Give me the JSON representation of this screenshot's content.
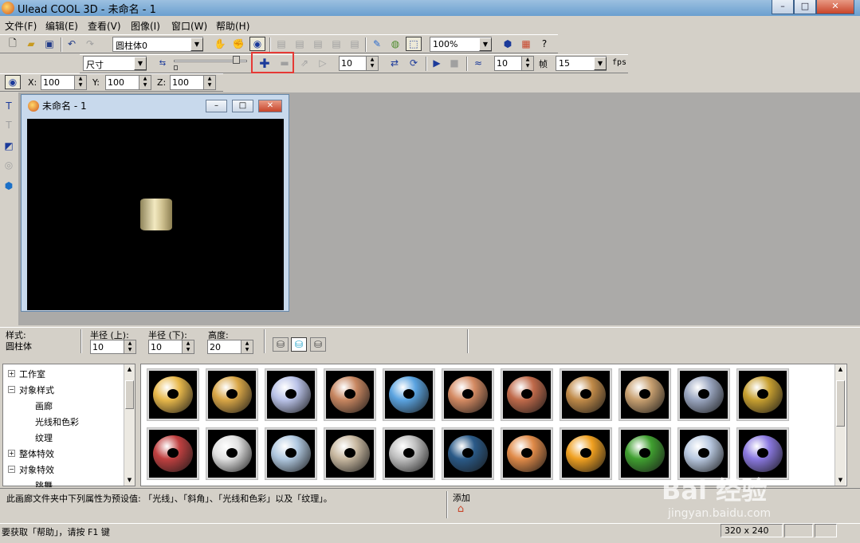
{
  "window": {
    "title": "Ulead COOL 3D - 未命名 - 1",
    "min": "–",
    "max": "□",
    "close": "✕"
  },
  "menu": [
    "文件(F)",
    "编辑(E)",
    "查看(V)",
    "图像(I)",
    "窗口(W)",
    "帮助(H)"
  ],
  "toolbar1": {
    "object_combo": "圆柱体0",
    "zoom_combo": "100%"
  },
  "toolbar2": {
    "size_combo": "尺寸",
    "frame_value": "10",
    "speed_value": "10",
    "frame_label": "帧",
    "fps_value": "15",
    "fps_label": "fps"
  },
  "toolbar3": {
    "x_label": "X:",
    "x_value": "100",
    "y_label": "Y:",
    "y_value": "100",
    "z_label": "Z:",
    "z_value": "100"
  },
  "child_window": {
    "title": "未命名 - 1"
  },
  "style_bar": {
    "style_label": "样式:",
    "style_value": "圆柱体",
    "radius_top_label": "半径 (上):",
    "radius_top_value": "10",
    "radius_bottom_label": "半径 (下):",
    "radius_bottom_value": "10",
    "height_label": "高度:",
    "height_value": "20"
  },
  "tree": [
    {
      "label": "工作室",
      "sign": "+"
    },
    {
      "label": "对象样式",
      "sign": "−"
    },
    {
      "label": "画廊"
    },
    {
      "label": "光线和色彩"
    },
    {
      "label": "纹理"
    },
    {
      "label": "整体特效",
      "sign": "+"
    },
    {
      "label": "对象特效",
      "sign": "−"
    },
    {
      "label": "跳舞"
    }
  ],
  "gallery_presets": [
    "#e8b84a",
    "#d9a646",
    "#b9c2e8",
    "#c78660",
    "#5aa3e0",
    "#d48a62",
    "#c06a4a",
    "#c08a48",
    "#c8a070",
    "#9aa6c0",
    "#c8a030",
    "#c04040",
    "#e0e0e0",
    "#b0c8e0",
    "#c8b8a0",
    "#c0c0c0",
    "#2a5a88",
    "#e08a48",
    "#f0a020",
    "#40a030",
    "#b8c8e0",
    "#8a78e0"
  ],
  "hint": {
    "text": "此画廊文件夹中下列属性为预设值: 「光线」、「斜角」、「光线和色彩」以及「纹理」。",
    "add_label": "添加"
  },
  "status": {
    "help": "要获取「帮助」，请按 F1 键",
    "size": "320 x 240"
  },
  "watermark": {
    "line1": "Bai 经验",
    "line2": "jingyan.baidu.com"
  }
}
